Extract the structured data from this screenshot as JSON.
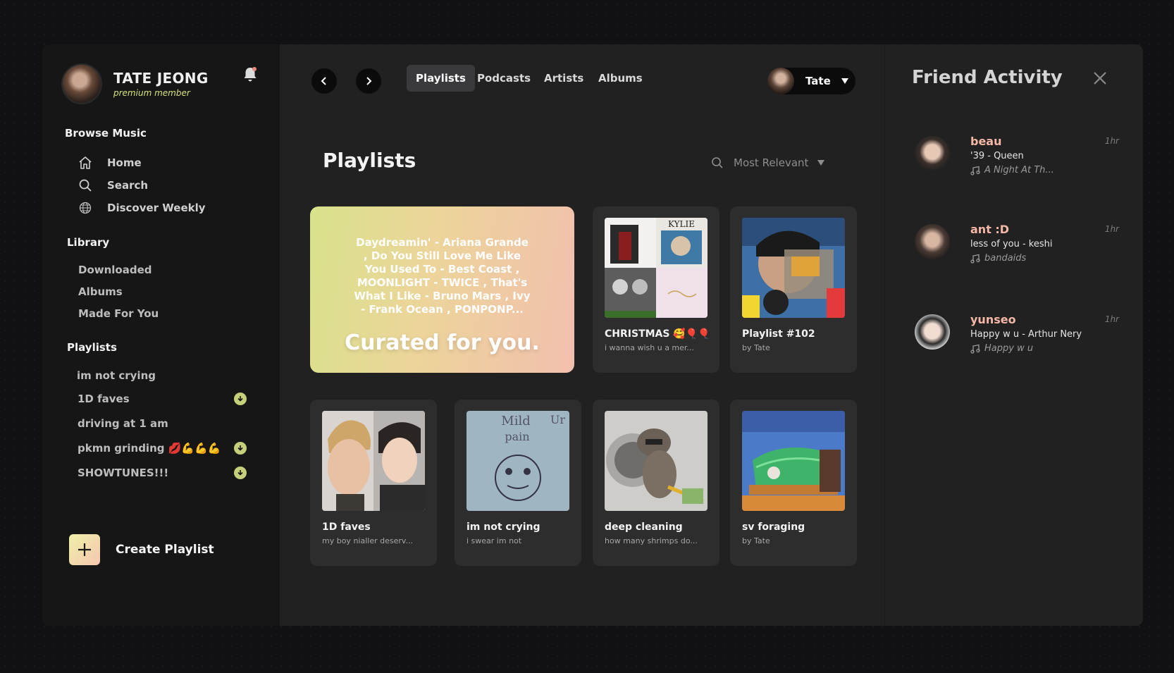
{
  "profile": {
    "name": "TATE JEONG",
    "subtitle": "premium member"
  },
  "browse": {
    "title": "Browse Music",
    "items": [
      {
        "label": "Home",
        "icon": "home-icon"
      },
      {
        "label": "Search",
        "icon": "search-icon"
      },
      {
        "label": "Discover Weekly",
        "icon": "globe-icon"
      }
    ]
  },
  "library": {
    "title": "Library",
    "items": [
      {
        "label": "Downloaded"
      },
      {
        "label": "Albums"
      },
      {
        "label": "Made For You"
      }
    ]
  },
  "playlists": {
    "title": "Playlists",
    "items": [
      {
        "label": "im not crying",
        "downloaded": false
      },
      {
        "label": "1D faves",
        "downloaded": true
      },
      {
        "label": "driving at 1 am",
        "downloaded": false
      },
      {
        "label": "pkmn grinding 💋💪💪💪",
        "downloaded": true
      },
      {
        "label": "SHOWTUNES!!!",
        "downloaded": true
      }
    ]
  },
  "create": {
    "label": "Create Playlist"
  },
  "topbar": {
    "tabs": [
      {
        "label": "Playlists",
        "active": true
      },
      {
        "label": "Podcasts",
        "active": false
      },
      {
        "label": "Artists",
        "active": false
      },
      {
        "label": "Albums",
        "active": false
      }
    ],
    "user": "Tate"
  },
  "main": {
    "title": "Playlists",
    "sort_label": "Most Relevant",
    "feature": {
      "songs_text": "Daydreamin' - Ariana Grande , Do You Still Love Me Like You Used To - Best Coast , MOONLIGHT - TWICE , That's What I Like - Bruno Mars , Ivy - Frank Ocean , PONPONP...",
      "tagline": "Curated for you."
    },
    "cards": [
      {
        "title": "CHRISTMAS 🥰🎈🎈",
        "subtitle": "i wanna wish u a mer..."
      },
      {
        "title": "Playlist #102",
        "subtitle": "by Tate"
      },
      {
        "title": "1D faves",
        "subtitle": "my boy nialler deserv..."
      },
      {
        "title": "im not crying",
        "subtitle": "i swear im not"
      },
      {
        "title": "deep cleaning",
        "subtitle": "how many shrimps do..."
      },
      {
        "title": "sv foraging",
        "subtitle": "by Tate"
      }
    ],
    "art_labels": {
      "kylie": "KYLIE",
      "mild": "Mild",
      "pain": "pain",
      "un": "Ur"
    }
  },
  "friends": {
    "title": "Friend Activity",
    "items": [
      {
        "name": "beau",
        "time": "1hr",
        "song": "'39 - Queen",
        "source": "A Night At Th..."
      },
      {
        "name": "ant :D",
        "time": "1hr",
        "song": "less of you - keshi",
        "source": "bandaids"
      },
      {
        "name": "yunseo",
        "time": "1hr",
        "song": "Happy w u - Arthur Nery",
        "source": "Happy w u"
      }
    ]
  },
  "colors": {
    "accent": "#d7e37c",
    "friend_name": "#f5b7a6",
    "download": "#c6cf7a"
  }
}
